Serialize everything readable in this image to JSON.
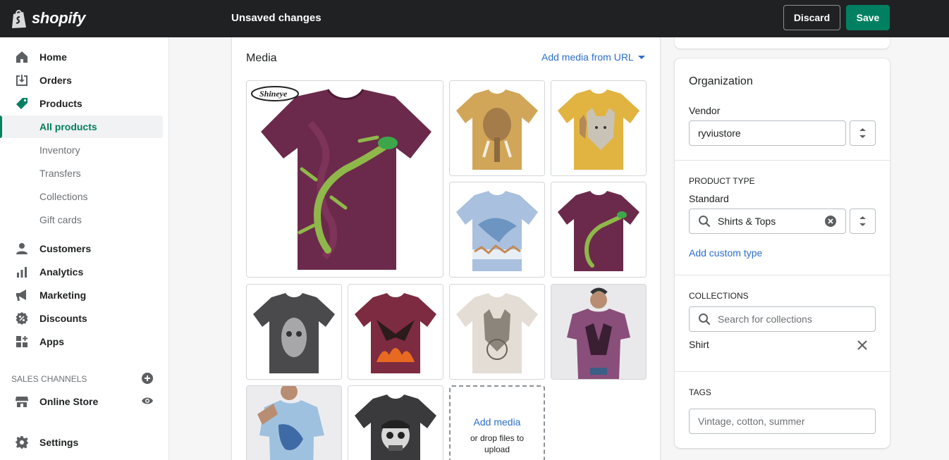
{
  "topbar": {
    "brand": "shopify",
    "title": "Unsaved changes",
    "discard_label": "Discard",
    "save_label": "Save"
  },
  "sidebar": {
    "items": [
      {
        "label": "Home",
        "icon": "home-icon"
      },
      {
        "label": "Orders",
        "icon": "orders-icon"
      },
      {
        "label": "Products",
        "icon": "tag-icon"
      },
      {
        "label": "Customers",
        "icon": "person-icon"
      },
      {
        "label": "Analytics",
        "icon": "bar-chart-icon"
      },
      {
        "label": "Marketing",
        "icon": "megaphone-icon"
      },
      {
        "label": "Discounts",
        "icon": "discount-icon"
      },
      {
        "label": "Apps",
        "icon": "apps-icon"
      }
    ],
    "product_subitems": [
      "All products",
      "Inventory",
      "Transfers",
      "Collections",
      "Gift cards"
    ],
    "sales_channels_label": "SALES CHANNELS",
    "online_store_label": "Online Store",
    "settings_label": "Settings"
  },
  "media": {
    "title": "Media",
    "add_from_url": "Add media from URL",
    "add_media": "Add media",
    "drop_hint": "or drop files to upload",
    "watermark": "Shineye"
  },
  "organization": {
    "title": "Organization",
    "vendor_label": "Vendor",
    "vendor_value": "ryviustore",
    "product_type_heading": "PRODUCT TYPE",
    "product_type_standard": "Standard",
    "product_type_value": "Shirts & Tops",
    "add_custom_type": "Add custom type",
    "collections_heading": "COLLECTIONS",
    "collections_placeholder": "Search for collections",
    "collection_item": "Shirt",
    "tags_heading": "TAGS",
    "tags_placeholder": "Vintage, cotton, summer"
  },
  "colors": {
    "accent": "#008060",
    "link": "#2c6ecb",
    "topbar": "#202123"
  }
}
